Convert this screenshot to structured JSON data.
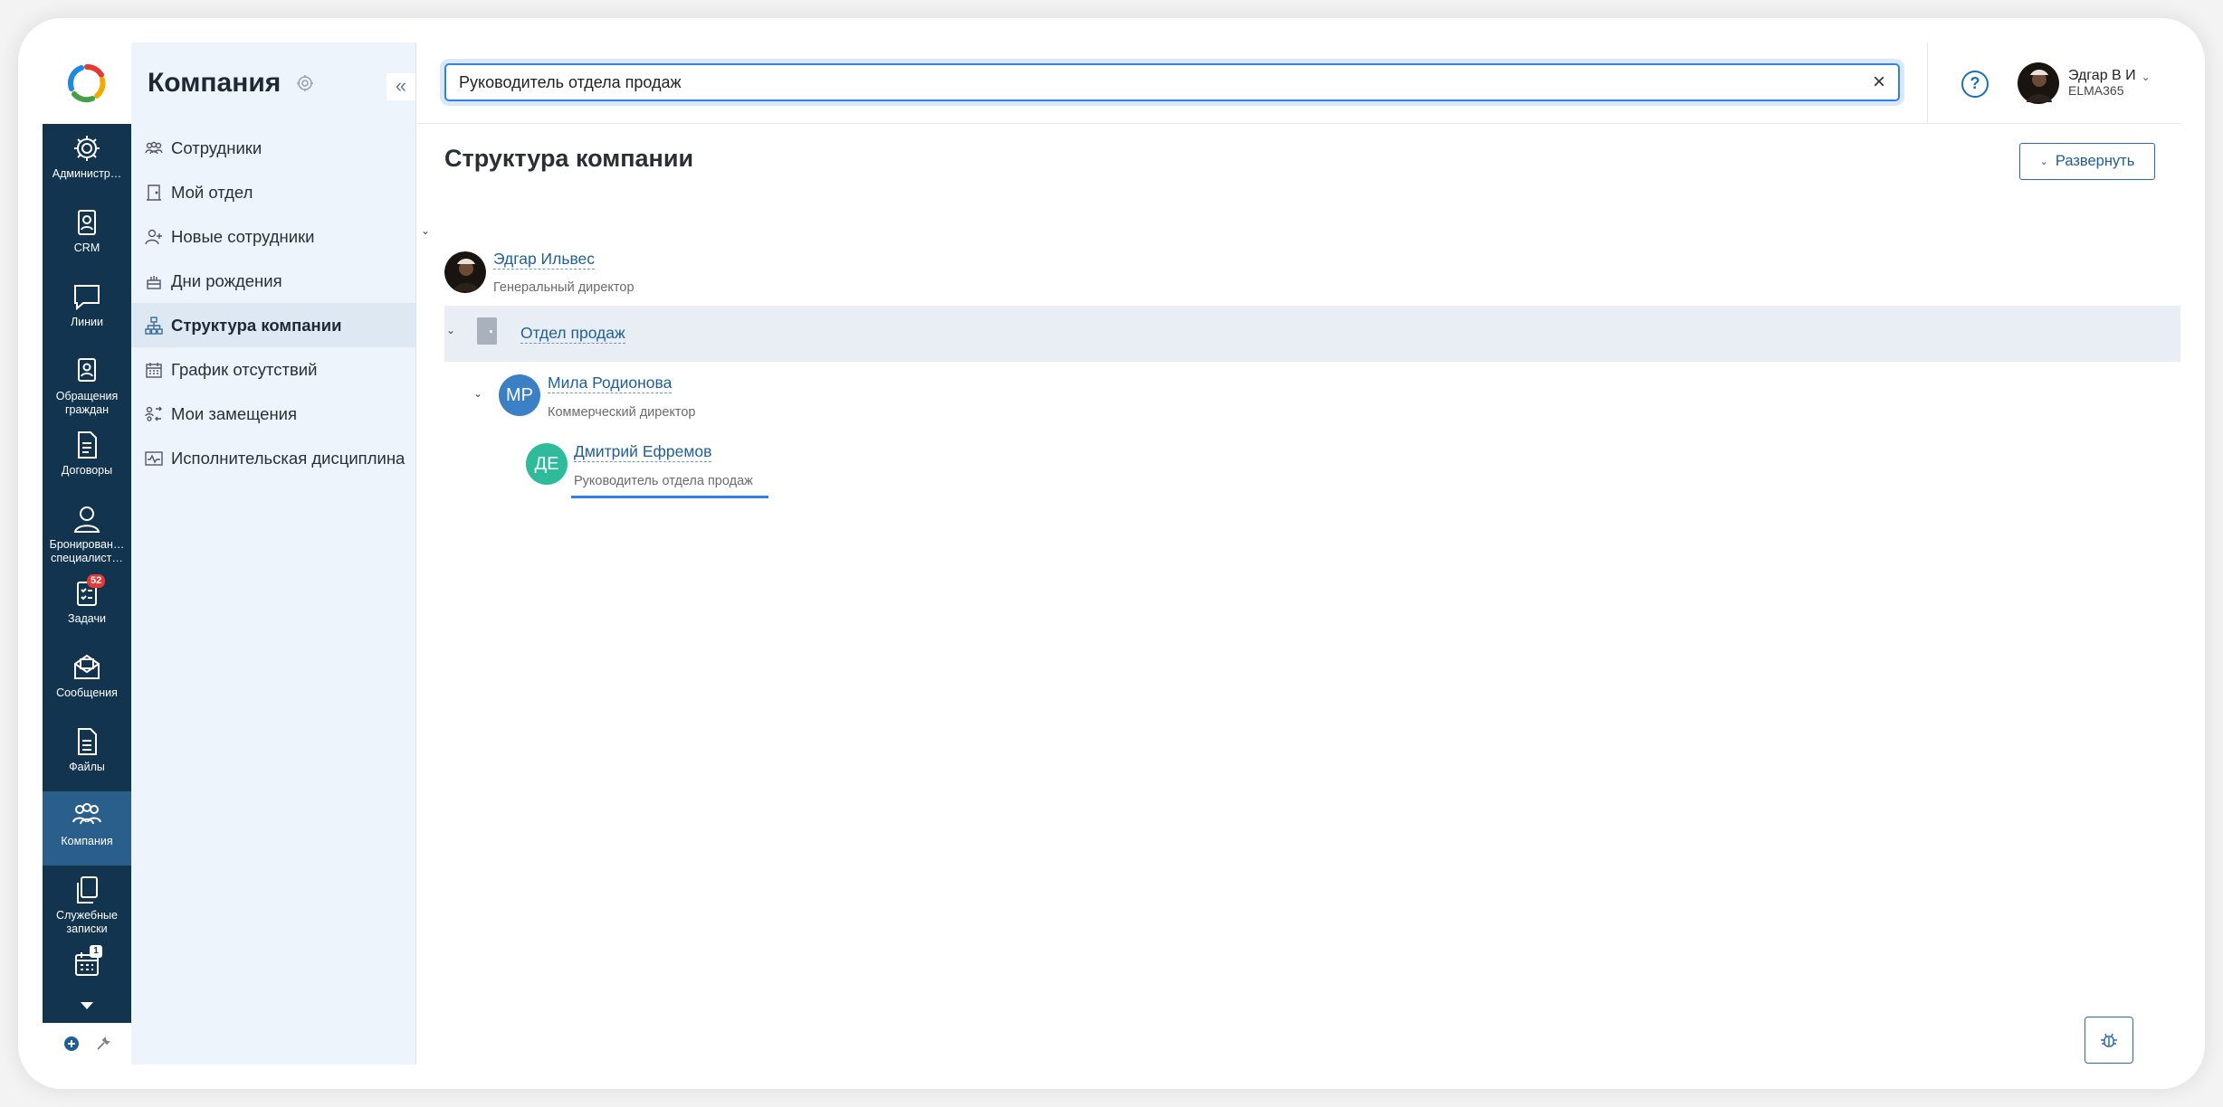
{
  "rail": {
    "items": [
      {
        "label": "Администр…",
        "icon": "gear-icon"
      },
      {
        "label": "CRM",
        "icon": "contact-card-icon"
      },
      {
        "label": "Линии",
        "icon": "chat-icon"
      },
      {
        "label": "Обращения\nграждан",
        "icon": "citizen-card-icon"
      },
      {
        "label": "Договоры",
        "icon": "document-icon"
      },
      {
        "label": "Бронирован…\nспециалист…",
        "icon": "person-icon"
      },
      {
        "label": "Задачи",
        "icon": "tasks-icon",
        "badge": "52"
      },
      {
        "label": "Сообщения",
        "icon": "envelope-icon"
      },
      {
        "label": "Файлы",
        "icon": "file-icon"
      },
      {
        "label": "Компания",
        "icon": "people-group-icon",
        "active": true
      },
      {
        "label": "Служебные\nзаписки",
        "icon": "copy-docs-icon"
      },
      {
        "label": "",
        "icon": "calendar-icon",
        "badge": "1"
      }
    ]
  },
  "sidebar": {
    "title": "Компания",
    "collapse_label": "«",
    "items": [
      {
        "label": "Сотрудники",
        "icon": "employees-icon"
      },
      {
        "label": "Мой отдел",
        "icon": "door-icon"
      },
      {
        "label": "Новые сотрудники",
        "icon": "add-user-icon"
      },
      {
        "label": "Дни рождения",
        "icon": "cake-icon"
      },
      {
        "label": "Структура компании",
        "icon": "org-structure-icon",
        "active": true
      },
      {
        "label": "График отсутствий",
        "icon": "calendar-grid-icon"
      },
      {
        "label": "Мои замещения",
        "icon": "substitution-icon"
      },
      {
        "label": "Исполнительская дисциплина",
        "icon": "chart-line-icon"
      }
    ]
  },
  "topbar": {
    "search_value": "Руководитель отдела продаж",
    "clear_label": "×",
    "help_label": "?",
    "user_name": "Эдгар В И",
    "user_org": "ELMA365"
  },
  "main": {
    "page_title": "Структура компании",
    "expand_label": "Развернуть",
    "tree": {
      "ceo": {
        "name": "Эдгар Ильвес",
        "position": "Генеральный директор"
      },
      "department": {
        "name": "Отдел продаж"
      },
      "head": {
        "name": "Мила Родионова",
        "position": "Коммерческий директор",
        "initials": "МР",
        "color": "#3b7fc4"
      },
      "member": {
        "name": "Дмитрий Ефремов",
        "position": "Руководитель отдела продаж",
        "initials": "ДЕ",
        "color": "#2dbb9c"
      }
    }
  },
  "colors": {
    "rail": "#13344f",
    "rail_active": "#2a5f8c",
    "sidebar_bg": "#eef4fb",
    "accent": "#1f5f99",
    "search_focus": "#2f80ed"
  }
}
